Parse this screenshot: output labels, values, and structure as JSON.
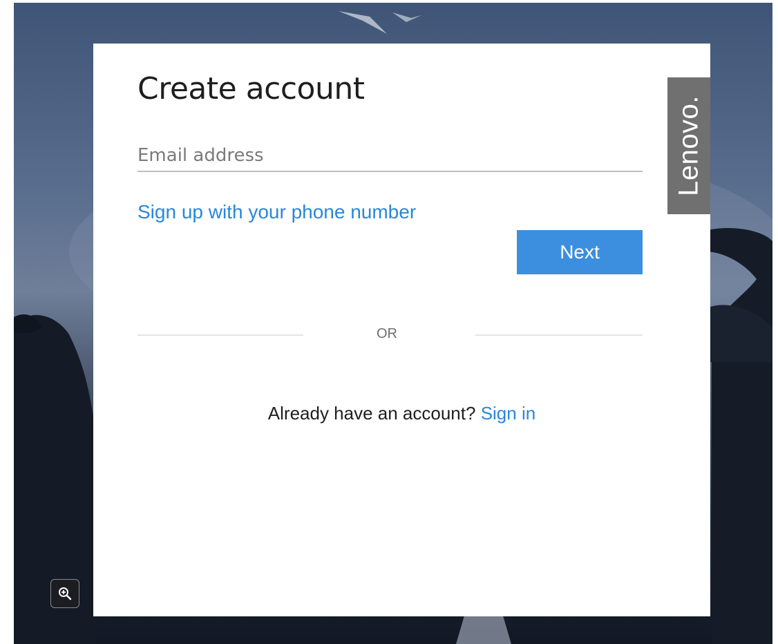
{
  "page": {
    "title": "Create account",
    "email_placeholder": "Email address",
    "email_value": "",
    "phone_link": "Sign up with your phone number",
    "next_label": "Next",
    "divider_text": "OR",
    "signin_prompt": "Already have an account?",
    "signin_link": "Sign in"
  },
  "brand": {
    "logo_text": "Lenovo."
  },
  "icons": {
    "zoom": "zoom-in-icon"
  },
  "colors": {
    "link": "#2a86d9",
    "primary_button": "#3c8fdf",
    "brand_tab": "#707070"
  }
}
